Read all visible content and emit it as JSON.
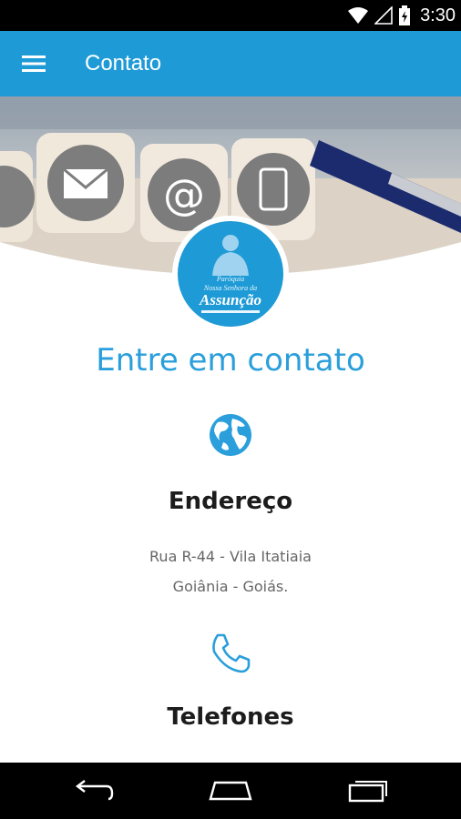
{
  "status_bar": {
    "time": "3:30"
  },
  "app_bar": {
    "title": "Contato"
  },
  "logo": {
    "line1": "Paróquia",
    "line2": "Nossa Senhora da",
    "line3": "Assunção"
  },
  "heading": "Entre em contato",
  "address": {
    "title": "Endereço",
    "line1": "Rua R-44 - Vila Itatiaia",
    "line2": "Goiânia - Goiás.",
    "icon": "globe-icon"
  },
  "phones": {
    "title": "Telefones",
    "icon": "phone-icon"
  },
  "colors": {
    "primary": "#1e9ad6",
    "heading": "#2a9fdb"
  }
}
